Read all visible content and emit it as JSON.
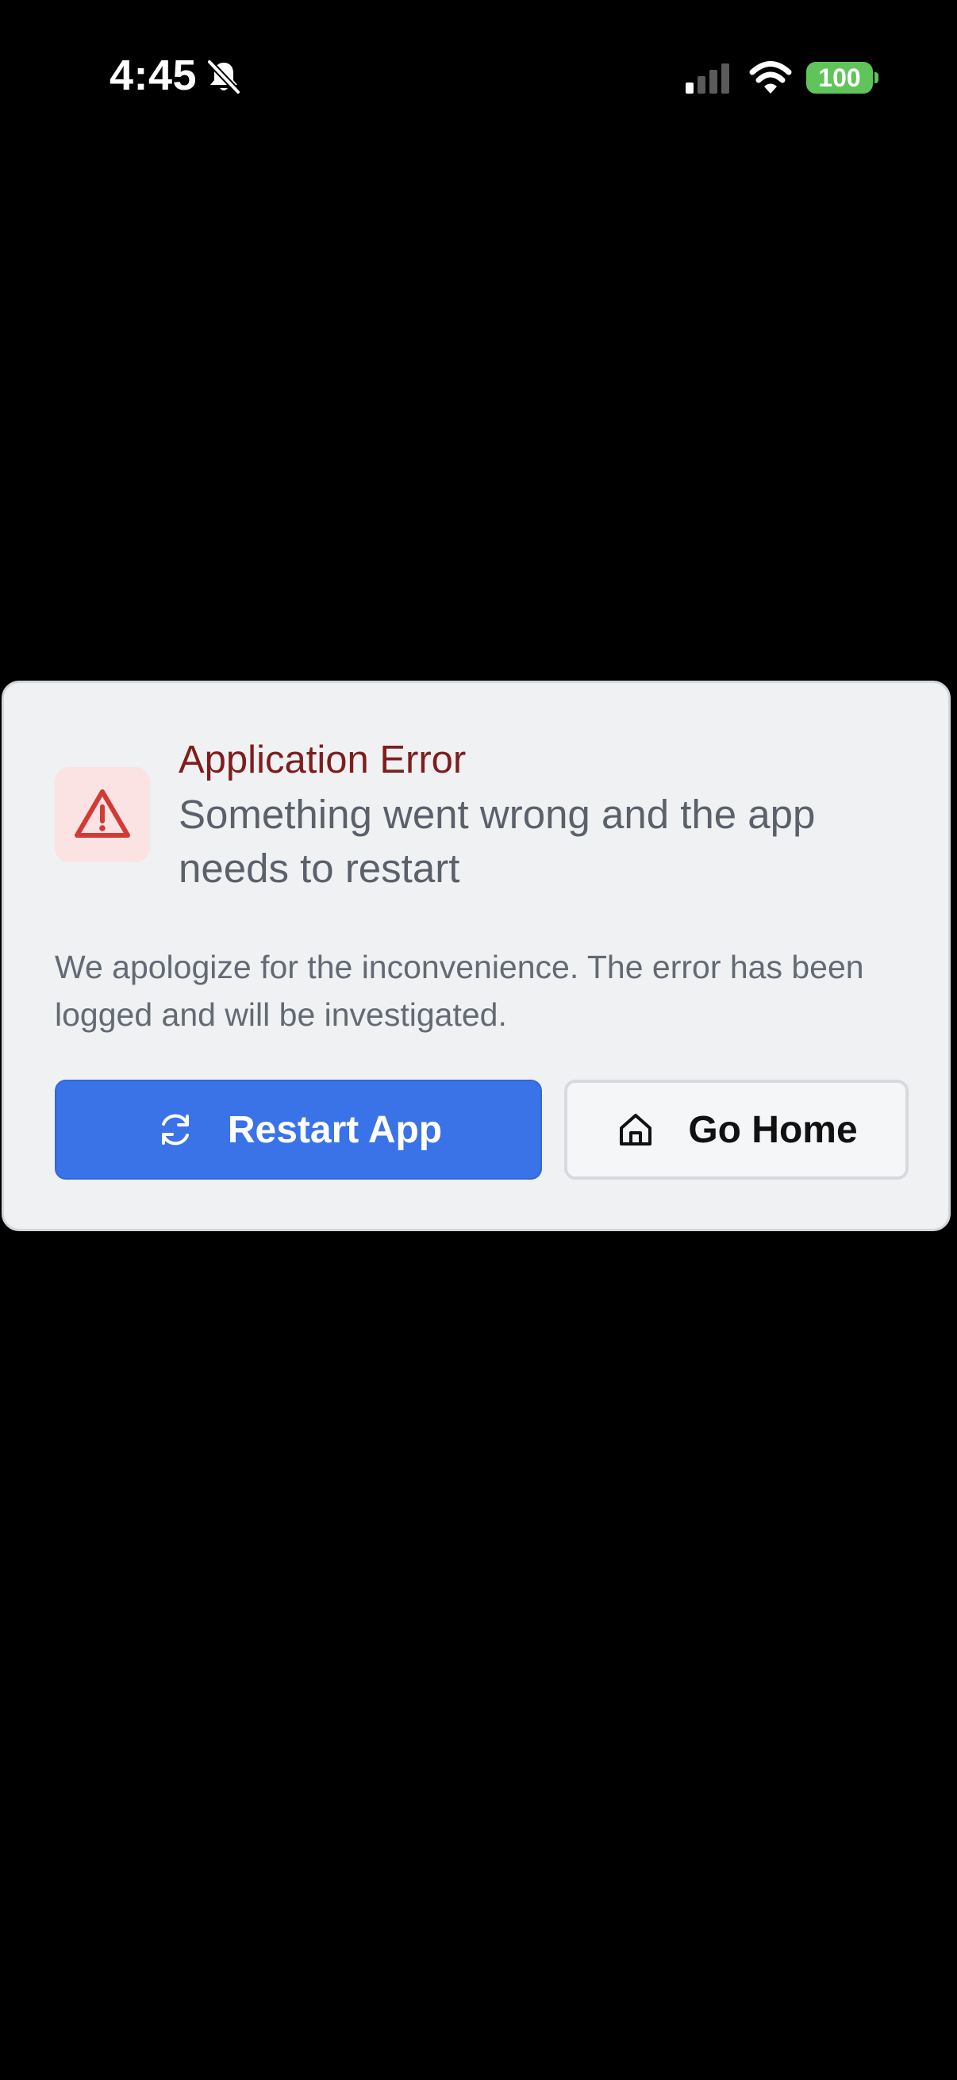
{
  "status_bar": {
    "time": "4:45",
    "battery_level": "100",
    "icons": [
      "bell-slash-icon",
      "cellular-signal-icon",
      "wifi-icon",
      "battery-icon"
    ]
  },
  "error": {
    "title": "Application Error",
    "subtitle": "Something went wrong and the app needs to restart",
    "description": "We apologize for the inconvenience. The error has been logged and will be investigated.",
    "icon": "warning-triangle-icon"
  },
  "buttons": {
    "restart_label": "Restart App",
    "restart_icon": "refresh-icon",
    "home_label": "Go Home",
    "home_icon": "home-icon"
  },
  "colors": {
    "background": "#000000",
    "card": "#f0f1f3",
    "title": "#7f1d1d",
    "warning_icon": "#d33a34",
    "primary_button": "#3a73e8",
    "battery": "#5fc45a"
  }
}
